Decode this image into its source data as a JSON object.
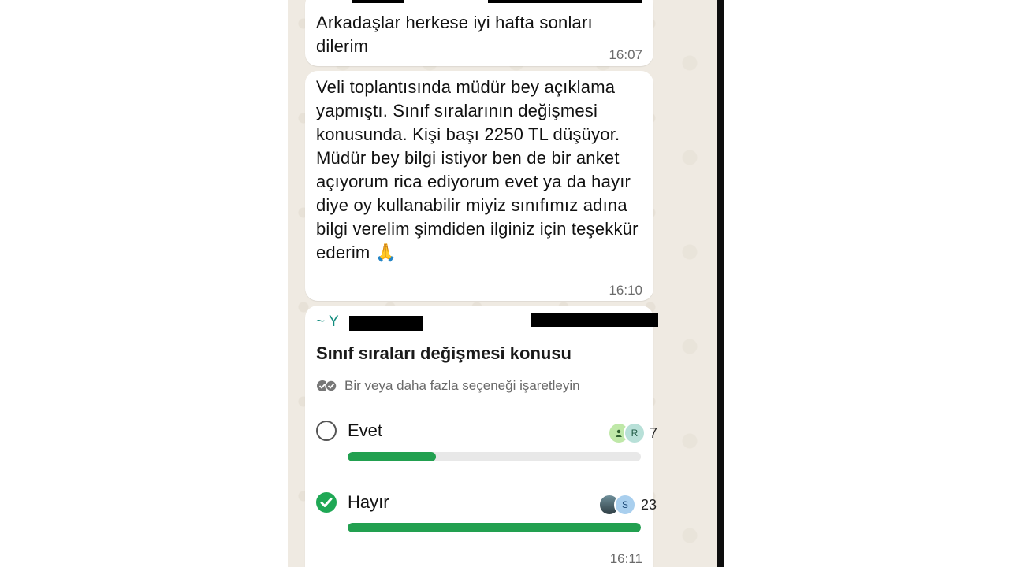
{
  "messages": [
    {
      "text": "Arkadaşlar herkese iyi hafta sonları dilerim",
      "time": "16:07"
    },
    {
      "text": "Veli toplantısında müdür bey açıklama yapmıştı. Sınıf sıralarının değişmesi konusunda. Kişi başı 2250 TL düşüyor. Müdür bey bilgi istiyor ben de bir anket açıyorum rica ediyorum evet ya da hayır diye oy kullanabilir miyiz sınıfımız adına bilgi verelim şimdiden ilginiz için teşekkür ederim 🙏",
      "time": "16:10"
    }
  ],
  "poll": {
    "sender_prefix": "~ Y",
    "title": "Sınıf sıraları değişmesi konusu",
    "hint": "Bir veya daha fazla seçeneği işaretleyin",
    "hint_icon": "double-check-icon",
    "options": [
      {
        "label": "Evet",
        "votes": "7",
        "selected": false,
        "fill_fraction": 0.3,
        "avatars": [
          "person-icon",
          "R"
        ]
      },
      {
        "label": "Hayır",
        "votes": "23",
        "selected": true,
        "fill_fraction": 1.0,
        "avatars": [
          "photo",
          "S"
        ]
      }
    ],
    "time": "16:11"
  },
  "colors": {
    "accent": "#1fa855",
    "sender": "#128c7e",
    "chat_bg": "#efeae2"
  }
}
